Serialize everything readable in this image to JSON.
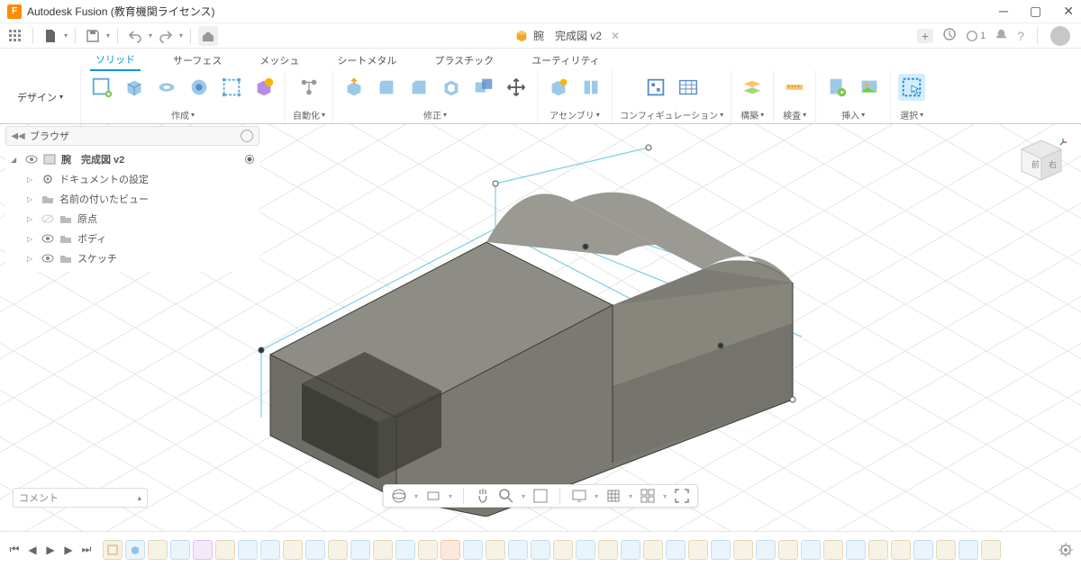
{
  "titlebar": {
    "app": "Autodesk Fusion (教育機関ライセンス)"
  },
  "tab": {
    "title": "腕　完成図 v2",
    "notif_count": "1"
  },
  "ribtabs": [
    "ソリッド",
    "サーフェス",
    "メッシュ",
    "シートメタル",
    "プラスチック",
    "ユーティリティ"
  ],
  "design_label": "デザイン",
  "ribbon_groups": {
    "create": "作成",
    "automate": "自動化",
    "modify": "修正",
    "assemble": "アセンブリ",
    "configure": "コンフィギュレーション",
    "construct": "構築",
    "inspect": "検査",
    "insert": "挿入",
    "select": "選択"
  },
  "browser": {
    "title": "ブラウザ",
    "root": "腕　完成図 v2",
    "items": [
      "ドキュメントの設定",
      "名前の付いたビュー",
      "原点",
      "ボディ",
      "スケッチ"
    ]
  },
  "comment_label": "コメント",
  "viewcube": {
    "front": "前",
    "right": "右"
  }
}
